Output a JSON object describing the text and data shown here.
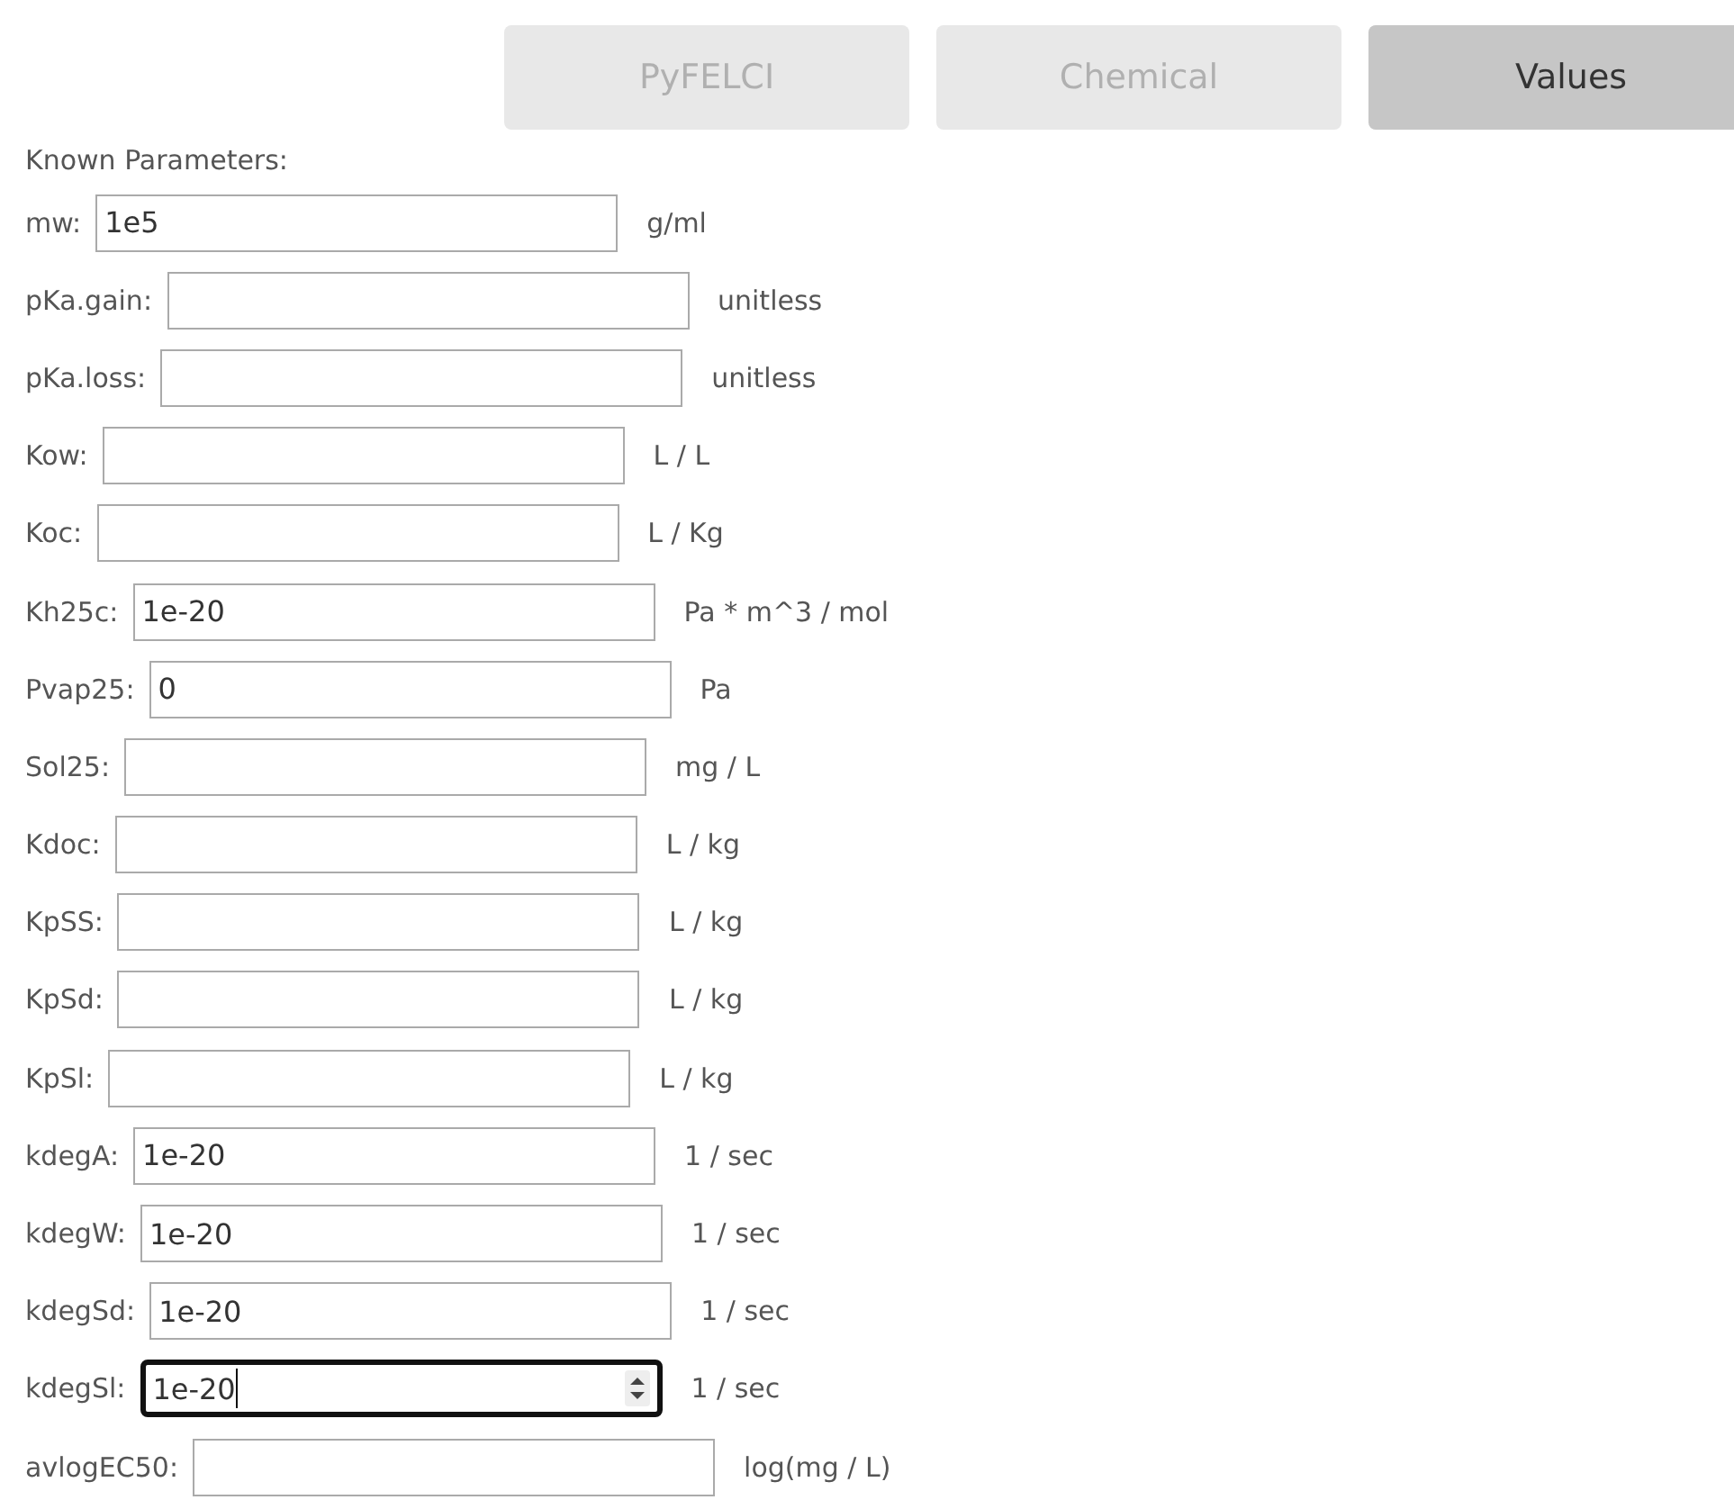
{
  "tabs": [
    {
      "label": "PyFELCI",
      "selected": false
    },
    {
      "label": "Chemical",
      "selected": false
    },
    {
      "label": "Values",
      "selected": true
    }
  ],
  "heading": "Known Parameters:",
  "fields": [
    {
      "label": "mw:",
      "value": "1e5",
      "unit": "g/ml",
      "focused": false
    },
    {
      "label": "pKa.gain:",
      "unit": "unitless",
      "focused": false
    },
    {
      "label": "pKa.loss:",
      "unit": "unitless",
      "focused": false
    },
    {
      "label": "Kow:",
      "unit": "L / L",
      "focused": false
    },
    {
      "label": "Koc:",
      "unit": "L / Kg",
      "focused": false
    },
    {
      "label": "Kh25c:",
      "value": "1e-20",
      "unit": "Pa * m^3 / mol",
      "focused": false
    },
    {
      "label": "Pvap25:",
      "value": "0",
      "unit": "Pa",
      "focused": false
    },
    {
      "label": "Sol25:",
      "unit": "mg / L",
      "focused": false
    },
    {
      "label": "Kdoc:",
      "unit": "L / kg",
      "focused": false
    },
    {
      "label": "KpSS:",
      "unit": "L / kg",
      "focused": false
    },
    {
      "label": "KpSd:",
      "unit": "L / kg",
      "focused": false
    },
    {
      "label": "KpSl:",
      "unit": "L / kg",
      "focused": false
    },
    {
      "label": "kdegA:",
      "value": "1e-20",
      "unit": "1 / sec",
      "focused": false
    },
    {
      "label": "kdegW:",
      "value": "1e-20",
      "unit": "1 / sec",
      "focused": false
    },
    {
      "label": "kdegSd:",
      "value": "1e-20",
      "unit": "1 / sec",
      "focused": false
    },
    {
      "label": "kdegSl:",
      "value": "1e-20",
      "unit": "1 / sec",
      "focused": true
    },
    {
      "label": "avlogEC50:",
      "unit": "log(mg / L)",
      "focused": false
    }
  ]
}
